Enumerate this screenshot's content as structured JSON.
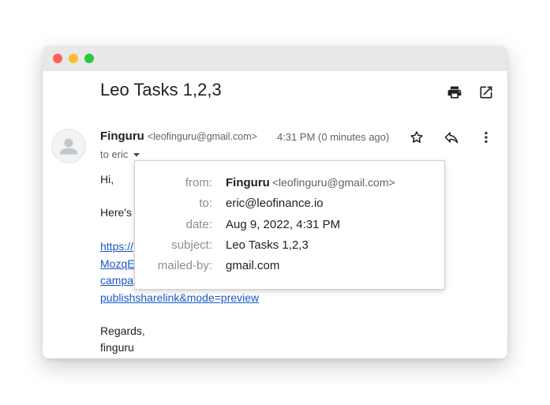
{
  "email": {
    "subject": "Leo Tasks 1,2,3",
    "sender_name": "Finguru",
    "sender_email": "<leofinguru@gmail.com>",
    "timestamp": "4:31 PM (0 minutes ago)",
    "to_line": "to eric",
    "body": {
      "greeting": "Hi,",
      "line2_start": "Here's",
      "link_fragments": [
        "https://",
        "MozqE",
        "campa",
        "publishsharelink&mode=preview"
      ],
      "regards": "Regards,",
      "signature": "finguru"
    }
  },
  "details_popup": {
    "from_label": "from:",
    "from_name": "Finguru",
    "from_email": "<leofinguru@gmail.com>",
    "to_label": "to:",
    "to_value": "eric@leofinance.io",
    "date_label": "date:",
    "date_value": "Aug 9, 2022, 4:31 PM",
    "subject_label": "subject:",
    "subject_value": "Leo Tasks 1,2,3",
    "mailedby_label": "mailed-by:",
    "mailedby_value": "gmail.com"
  },
  "icons": {
    "print": "print-icon",
    "open_new": "open-in-new-icon",
    "star": "star-icon",
    "reply": "reply-icon",
    "more": "more-vert-icon",
    "avatar": "person-icon",
    "caret": "caret-down-icon"
  },
  "colors": {
    "link": "#1a57c9",
    "text_primary": "#202124",
    "text_secondary": "#5f6368",
    "label_gray": "#8a8d91",
    "titlebar": "#e8e8e8",
    "close_dot": "#ff5f57",
    "minimize_dot": "#febc2e",
    "maximize_dot": "#28c840"
  }
}
